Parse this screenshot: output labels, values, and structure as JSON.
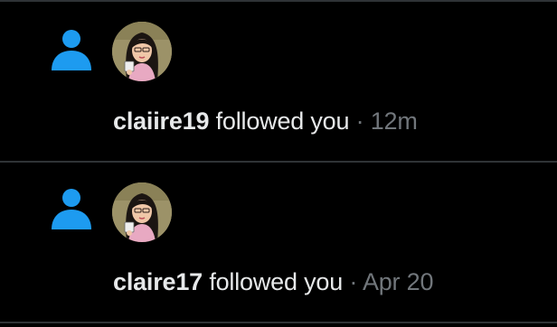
{
  "colors": {
    "background": "#000000",
    "divider": "#2f3336",
    "accent": "#1d9bf0",
    "text_primary": "#e7e9ea",
    "text_secondary": "#71767b"
  },
  "notifications": [
    {
      "type_icon": "person-icon",
      "avatar": "user-avatar",
      "username": "claiire19",
      "action": "followed you",
      "separator": "·",
      "time": "12m"
    },
    {
      "type_icon": "person-icon",
      "avatar": "user-avatar",
      "username": "claire17",
      "action": "followed you",
      "separator": "·",
      "time": "Apr 20"
    }
  ]
}
